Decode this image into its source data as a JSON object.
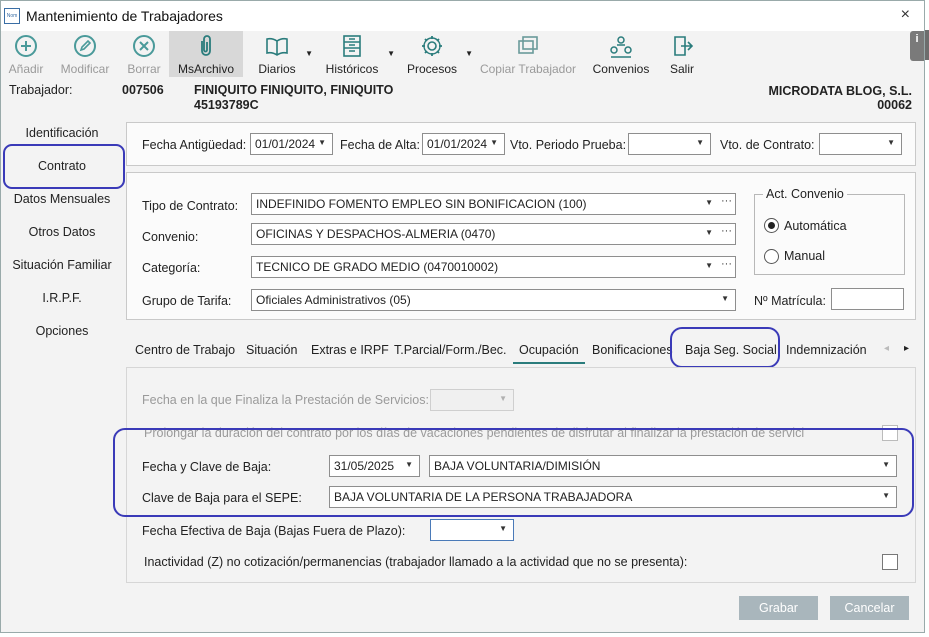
{
  "window": {
    "title": "Mantenimiento de Trabajadores",
    "icon_text": "Nom",
    "close": "×"
  },
  "toolbar": {
    "anadir": "Añadir",
    "modificar": "Modificar",
    "borrar": "Borrar",
    "msarchivo": "MsArchivo",
    "diarios": "Diarios",
    "historicos": "Históricos",
    "procesos": "Procesos",
    "copiar": "Copiar Trabajador",
    "convenios": "Convenios",
    "salir": "Salir",
    "info": "i"
  },
  "employee": {
    "label": "Trabajador:",
    "code": "007506",
    "name": "FINIQUITO FINIQUITO, FINIQUITO",
    "nif": "45193789C",
    "company": "MICRODATA BLOG, S.L.",
    "company_code": "00062"
  },
  "sidebar": {
    "items": [
      "Identificación",
      "Contrato",
      "Datos Mensuales",
      "Otros Datos",
      "Situación Familiar",
      "I.R.P.F.",
      "Opciones"
    ],
    "selected": "Contrato"
  },
  "dates": {
    "antiguedad_label": "Fecha Antigüedad:",
    "antiguedad_value": "01/01/2024",
    "alta_label": "Fecha de Alta:",
    "alta_value": "01/01/2024",
    "prueba_label": "Vto. Periodo Prueba:",
    "prueba_value": "",
    "contrato_label": "Vto. de Contrato:",
    "contrato_value": ""
  },
  "contract": {
    "tipo_label": "Tipo de Contrato:",
    "tipo_value": "INDEFINIDO FOMENTO EMPLEO SIN BONIFICACION (100)",
    "convenio_label": "Convenio:",
    "convenio_value": "OFICINAS Y DESPACHOS-ALMERIA (0470)",
    "categoria_label": "Categoría:",
    "categoria_value": "TECNICO DE GRADO MEDIO (0470010002)",
    "grupo_label": "Grupo de Tarifa:",
    "grupo_value": "Oficiales Administrativos (05)",
    "act_convenio_label": "Act. Convenio",
    "automatica": "Automática",
    "manual": "Manual",
    "matricula_label": "Nº Matrícula:",
    "matricula_value": ""
  },
  "tabs": [
    "Centro de Trabajo",
    "Situación",
    "Extras e IRPF",
    "T.Parcial/Form./Bec.",
    "Ocupación",
    "Bonificaciones",
    "Baja Seg. Social",
    "Indemnización"
  ],
  "tab_nav": {
    "prev": "◂",
    "next": "▸"
  },
  "baja": {
    "finaliza_label": "Fecha en la que Finaliza la Prestación de Servicios:",
    "prolongar_label": "Prolongar la duración del contrato por los días de vacaciones pendientes de disfrutar al finalizar la prestación de servicios.",
    "fecha_clave_label": "Fecha y Clave de Baja:",
    "fecha_value": "31/05/2025",
    "clave_value": "BAJA VOLUNTARIA/DIMISIÓN",
    "sepe_label": "Clave de Baja para el SEPE:",
    "sepe_value": "BAJA VOLUNTARIA DE LA PERSONA TRABAJADORA",
    "efectiva_label": "Fecha Efectiva de Baja (Bajas Fuera de Plazo):",
    "efectiva_value": "",
    "inactividad_label": "Inactividad (Z) no cotización/permanencias (trabajador llamado a la actividad que no se presenta):"
  },
  "buttons": {
    "grabar": "Grabar",
    "cancelar": "Cancelar"
  }
}
